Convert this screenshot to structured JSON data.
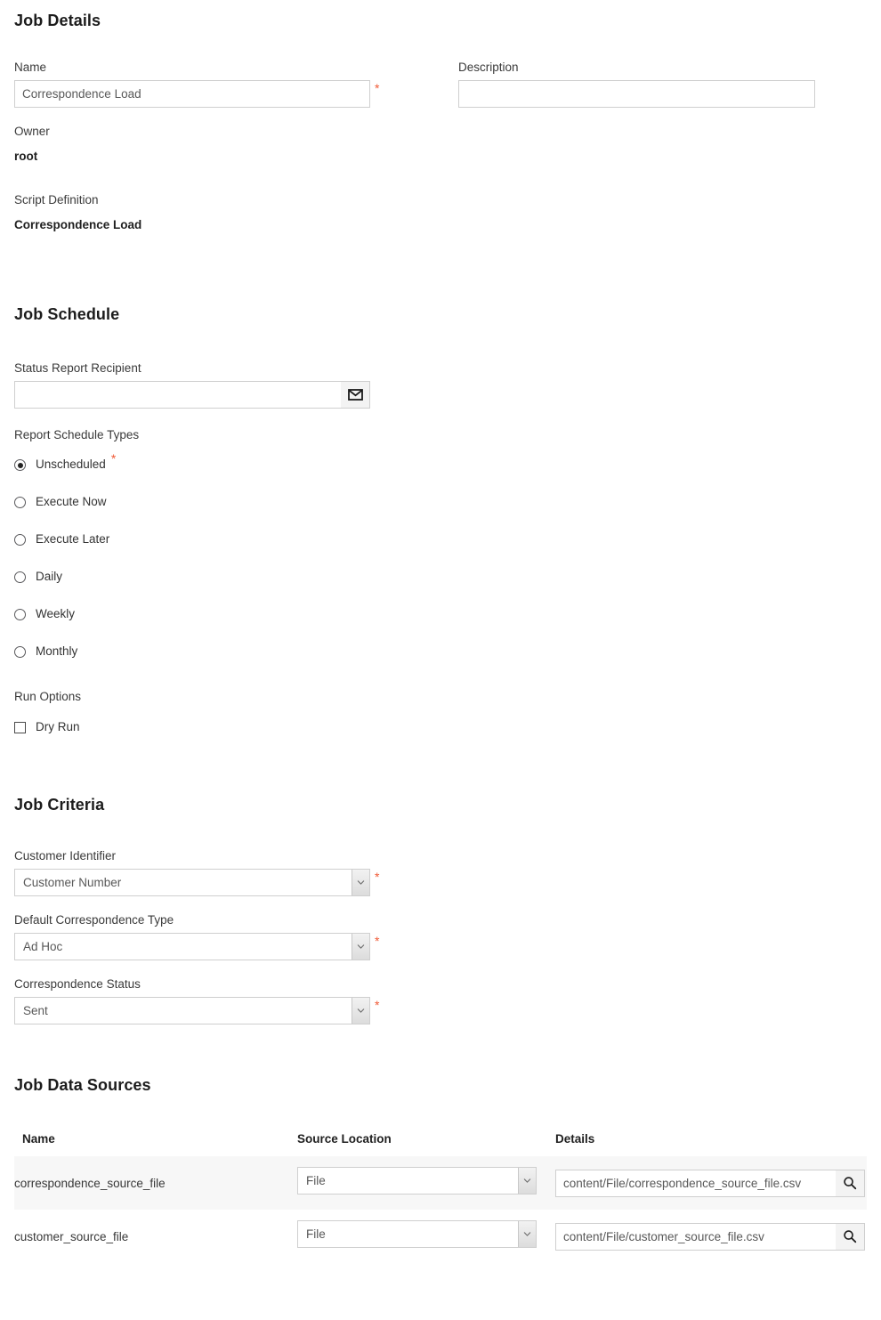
{
  "job_details": {
    "heading": "Job Details",
    "name_label": "Name",
    "name_value": "Correspondence Load",
    "description_label": "Description",
    "description_value": "",
    "description_placeholder": "",
    "owner_label": "Owner",
    "owner_value": "root",
    "script_definition_label": "Script Definition",
    "script_definition_value": "Correspondence Load",
    "required_marker": "*"
  },
  "job_schedule": {
    "heading": "Job Schedule",
    "recipient_label": "Status Report Recipient",
    "recipient_value": "",
    "recipient_placeholder": "",
    "recipient_button_icon": "envelope-icon",
    "schedule_types_label": "Report Schedule Types",
    "required_marker": "*",
    "schedule_types": [
      {
        "label": "Unscheduled",
        "selected": true,
        "required": true
      },
      {
        "label": "Execute Now",
        "selected": false,
        "required": false
      },
      {
        "label": "Execute Later",
        "selected": false,
        "required": false
      },
      {
        "label": "Daily",
        "selected": false,
        "required": false
      },
      {
        "label": "Weekly",
        "selected": false,
        "required": false
      },
      {
        "label": "Monthly",
        "selected": false,
        "required": false
      }
    ],
    "run_options_label": "Run Options",
    "dry_run_label": "Dry Run",
    "dry_run_checked": false
  },
  "job_criteria": {
    "heading": "Job Criteria",
    "required_marker": "*",
    "fields": [
      {
        "label": "Customer Identifier",
        "value": "Customer Number",
        "required": true
      },
      {
        "label": "Default Correspondence Type",
        "value": "Ad Hoc",
        "required": true
      },
      {
        "label": "Correspondence Status",
        "value": "Sent",
        "required": true
      }
    ]
  },
  "job_data_sources": {
    "heading": "Job Data Sources",
    "columns": [
      "Name",
      "Source Location",
      "Details"
    ],
    "rows": [
      {
        "name": "correspondence_source_file",
        "source_location": "File",
        "details": "content/File/correspondence_source_file.csv",
        "browse_icon": "search-icon"
      },
      {
        "name": "customer_source_file",
        "source_location": "File",
        "details": "content/File/customer_source_file.csv",
        "browse_icon": "search-icon"
      }
    ]
  },
  "colors": {
    "required_star": "#f05a36",
    "input_border": "#cfcfcf",
    "row_stripe": "#f7f7f7",
    "text": "#2b2b2b"
  }
}
